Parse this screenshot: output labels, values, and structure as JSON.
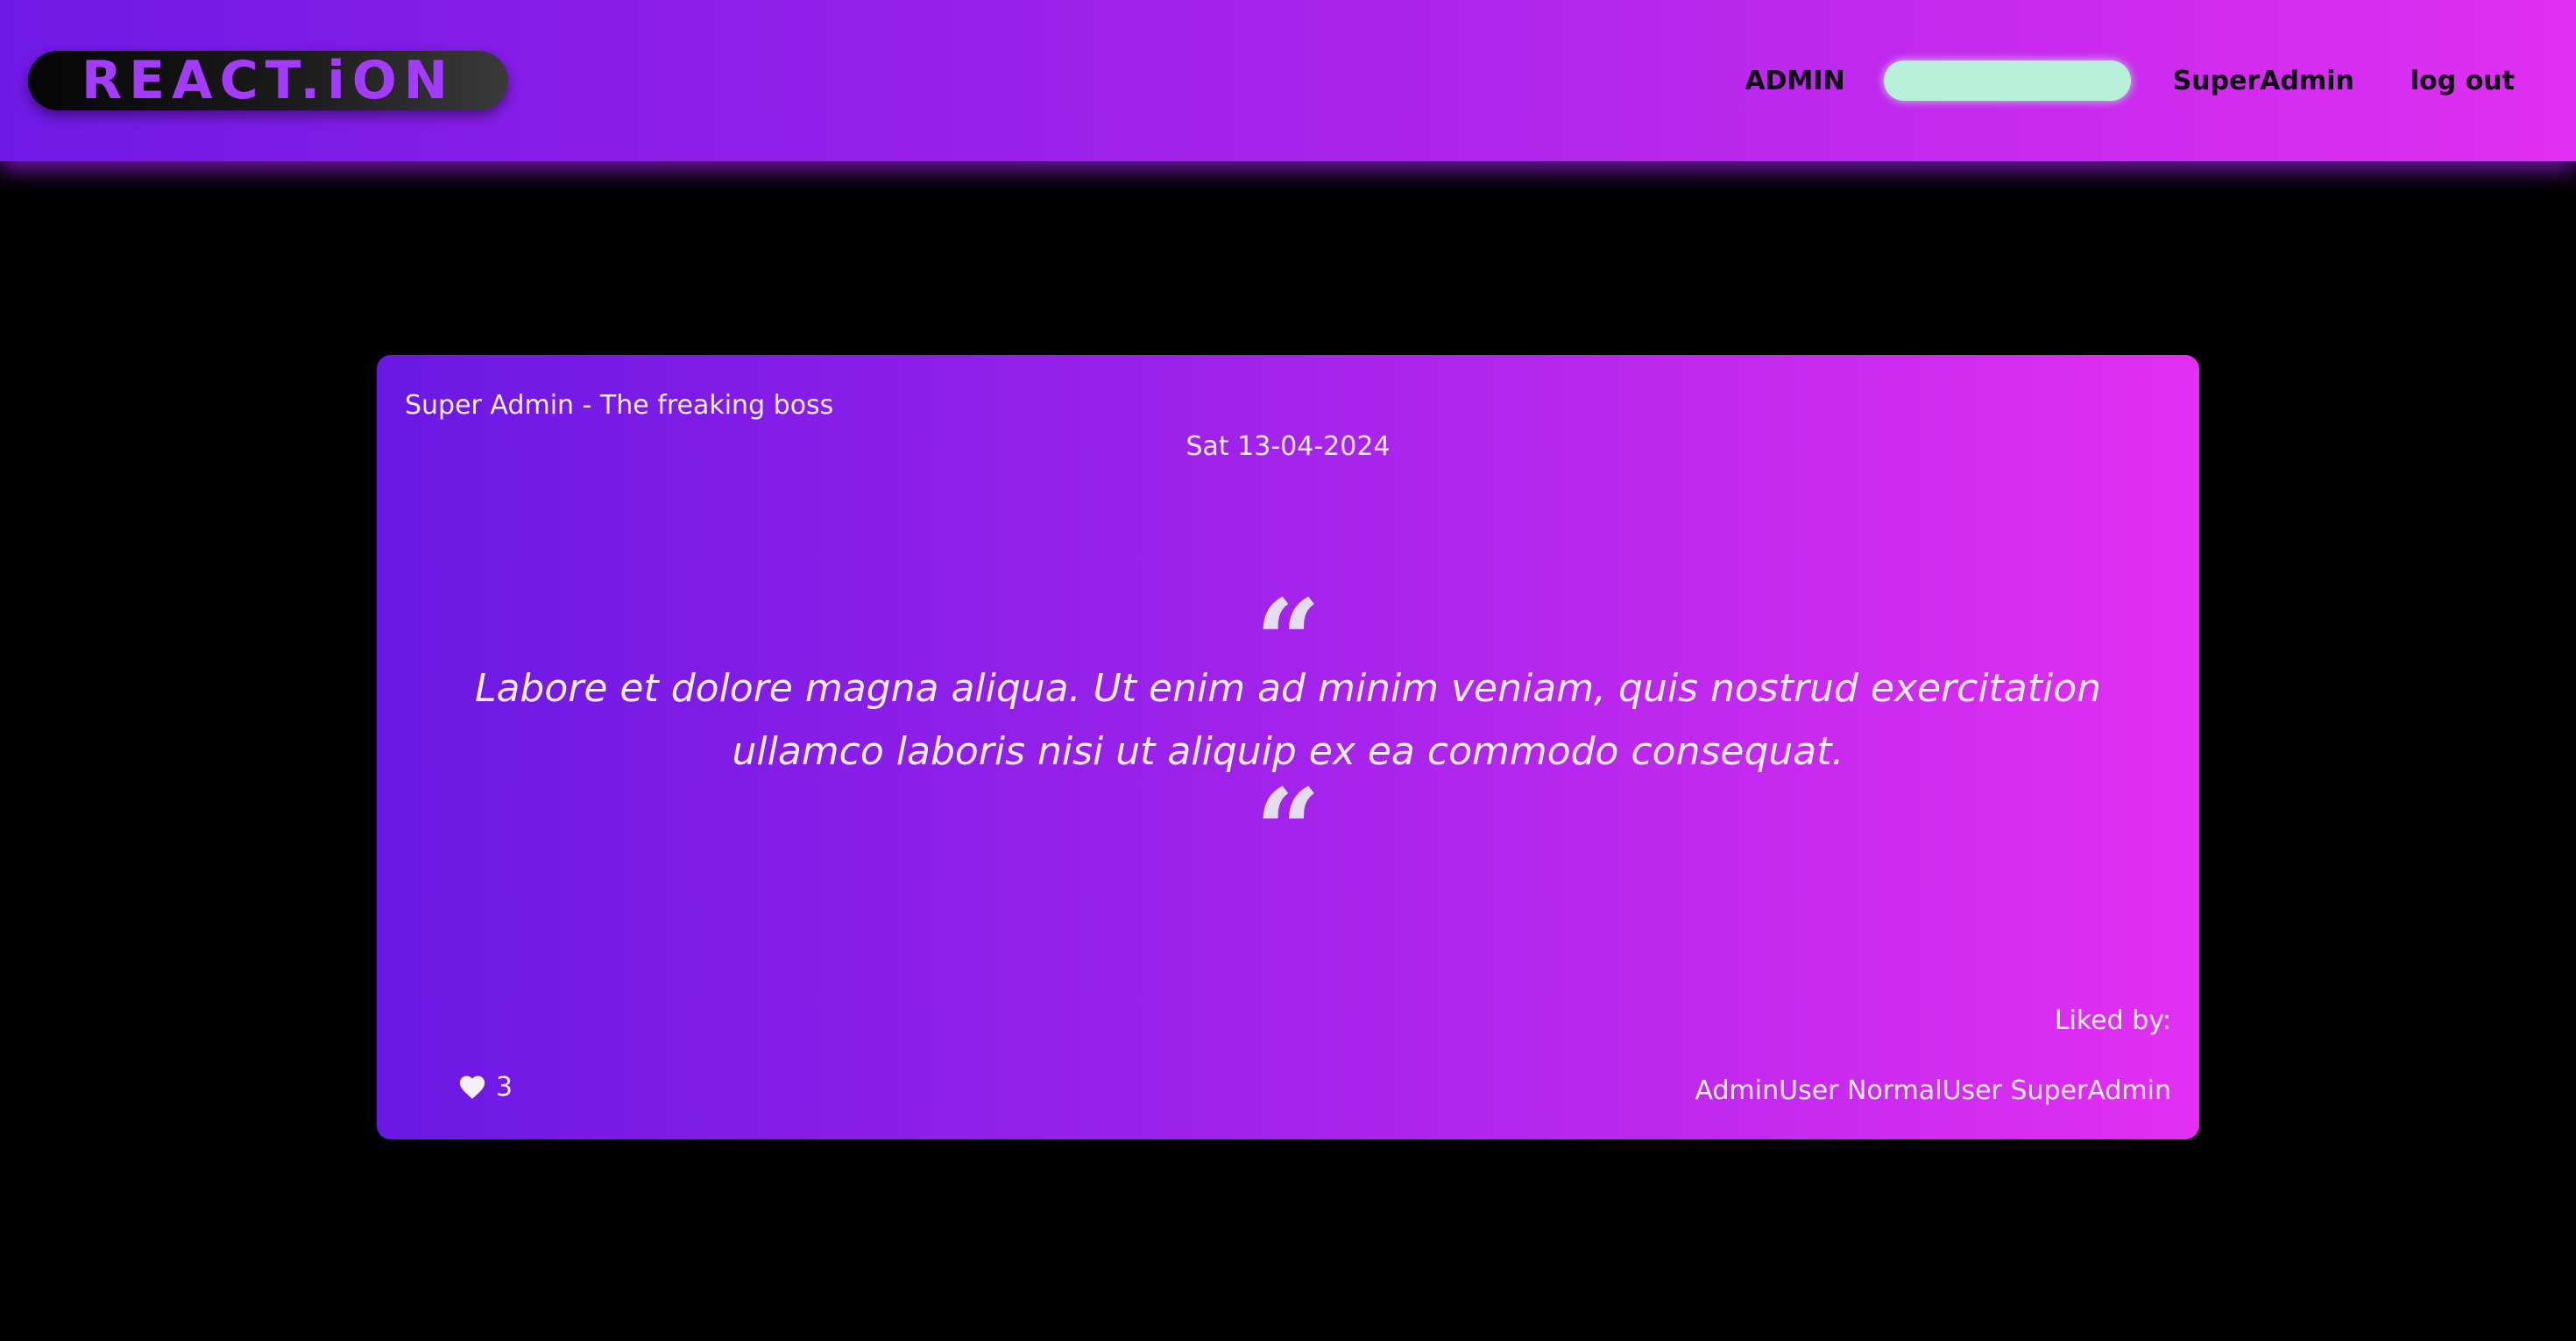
{
  "navbar": {
    "logo_text": "REACT.iON",
    "admin_label": "ADMIN",
    "search_value": "",
    "user_label": "SuperAdmin",
    "logout_label": "log out",
    "search_color": "#b8f0dc"
  },
  "post": {
    "author": "Super Admin - The freaking boss",
    "date": "Sat 13-04-2024",
    "quote_open": "“",
    "quote_close": "“",
    "text": "Labore et dolore magna aliqua. Ut enim ad minim veniam, quis nostrud exercitation ullamco laboris nisi ut aliquip ex ea commodo consequat.",
    "like_icon": "heart-icon",
    "like_count": "3",
    "liked_by_label": "Liked by:",
    "liked_by_users": "AdminUser NormalUser SuperAdmin"
  },
  "colors": {
    "gradient_start": "#6a18e4",
    "gradient_end": "#e32ff3",
    "background": "#000000"
  }
}
